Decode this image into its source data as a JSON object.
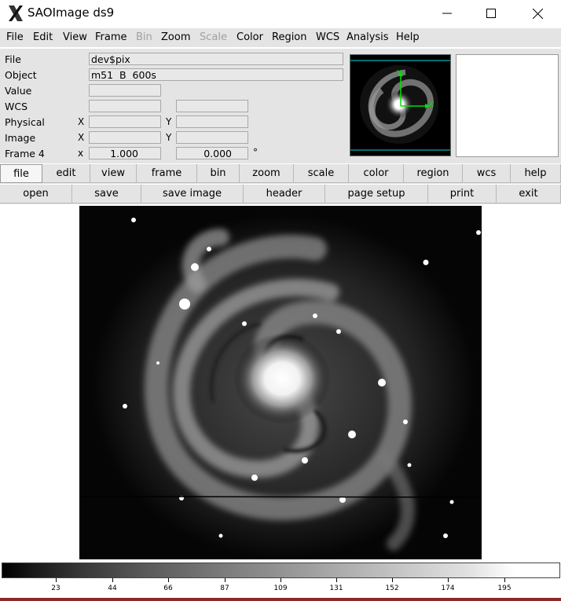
{
  "window": {
    "title": "SAOImage ds9",
    "icon": "x11-icon"
  },
  "menu": [
    "File",
    "Edit",
    "View",
    "Frame",
    "Bin",
    "Zoom",
    "Scale",
    "Color",
    "Region",
    "WCS",
    "Analysis",
    "Help"
  ],
  "menu_disabled": [
    "Bin",
    "Scale"
  ],
  "info": {
    "file_label": "File",
    "file_value": "dev$pix",
    "object_label": "Object",
    "object_value": "m51  B  600s",
    "value_label": "Value",
    "value_value": "",
    "wcs_label": "WCS",
    "physical_label": "Physical",
    "physical_x_axis": "X",
    "physical_y_axis": "Y",
    "image_label": "Image",
    "image_x_axis": "X",
    "image_y_axis": "Y",
    "frame_label": "Frame 4",
    "frame_x_axis": "x",
    "zoom_value": "1.000",
    "angle_value": "0.000",
    "angle_unit": "°"
  },
  "panner": {
    "axis_y": "Y",
    "axis_x": "X"
  },
  "buttons_row1": [
    "file",
    "edit",
    "view",
    "frame",
    "bin",
    "zoom",
    "scale",
    "color",
    "region",
    "wcs",
    "help"
  ],
  "buttons_row2": [
    "open",
    "save",
    "save image",
    "header",
    "page setup",
    "print",
    "exit"
  ],
  "colorbar": {
    "ticks": [
      "23",
      "44",
      "66",
      "87",
      "109",
      "131",
      "152",
      "174",
      "195"
    ]
  },
  "colors": {
    "menubar_bg": "#e4e4e4",
    "compass_green": "#00e000",
    "panner_frame_cyan": "#00e0e0"
  }
}
